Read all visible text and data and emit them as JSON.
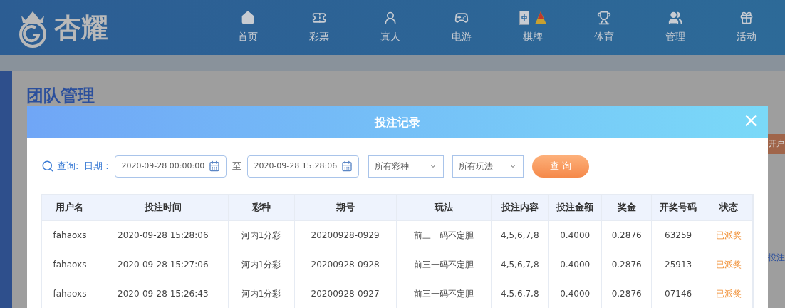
{
  "header": {
    "logo_text": "杏耀",
    "nav": [
      {
        "label": "首页",
        "kind": "home",
        "badge": false
      },
      {
        "label": "彩票",
        "kind": "ticket",
        "badge": false
      },
      {
        "label": "真人",
        "kind": "live",
        "badge": false
      },
      {
        "label": "电游",
        "kind": "slot",
        "badge": false
      },
      {
        "label": "棋牌",
        "kind": "mahjong",
        "badge": true
      },
      {
        "label": "体育",
        "kind": "trophy",
        "badge": false
      },
      {
        "label": "管理",
        "kind": "users",
        "badge": false
      },
      {
        "label": "活动",
        "kind": "gift",
        "badge": false
      }
    ]
  },
  "page": {
    "title": "团队管理",
    "side_button": "开户",
    "side_link": "投注"
  },
  "modal": {
    "title": "投注记录",
    "close": "×",
    "filter": {
      "search_label": "查询:",
      "date_label": "日期：",
      "start": "2020-09-28 00:00:00",
      "separator": "至",
      "end": "2020-09-28 15:28:06",
      "lottery": "所有彩种",
      "play": "所有玩法",
      "submit": "查 询"
    },
    "table": {
      "columns": [
        "用户名",
        "投注时间",
        "彩种",
        "期号",
        "玩法",
        "投注内容",
        "投注金额",
        "奖金",
        "开奖号码",
        "状态"
      ],
      "rows": [
        [
          "fahaoxs",
          "2020-09-28 15:28:06",
          "河内1分彩",
          "20200928-0929",
          "前三一码不定胆",
          "4,5,6,7,8",
          "0.4000",
          "0.2876",
          "63259",
          "已派奖"
        ],
        [
          "fahaoxs",
          "2020-09-28 15:27:06",
          "河内1分彩",
          "20200928-0928",
          "前三一码不定胆",
          "4,5,6,7,8",
          "0.4000",
          "0.2876",
          "25913",
          "已派奖"
        ],
        [
          "fahaoxs",
          "2020-09-28 15:26:43",
          "河内1分彩",
          "20200928-0927",
          "前三一码不定胆",
          "4,5,6,7,8",
          "0.4000",
          "0.2876",
          "07146",
          "已派奖"
        ]
      ]
    }
  }
}
